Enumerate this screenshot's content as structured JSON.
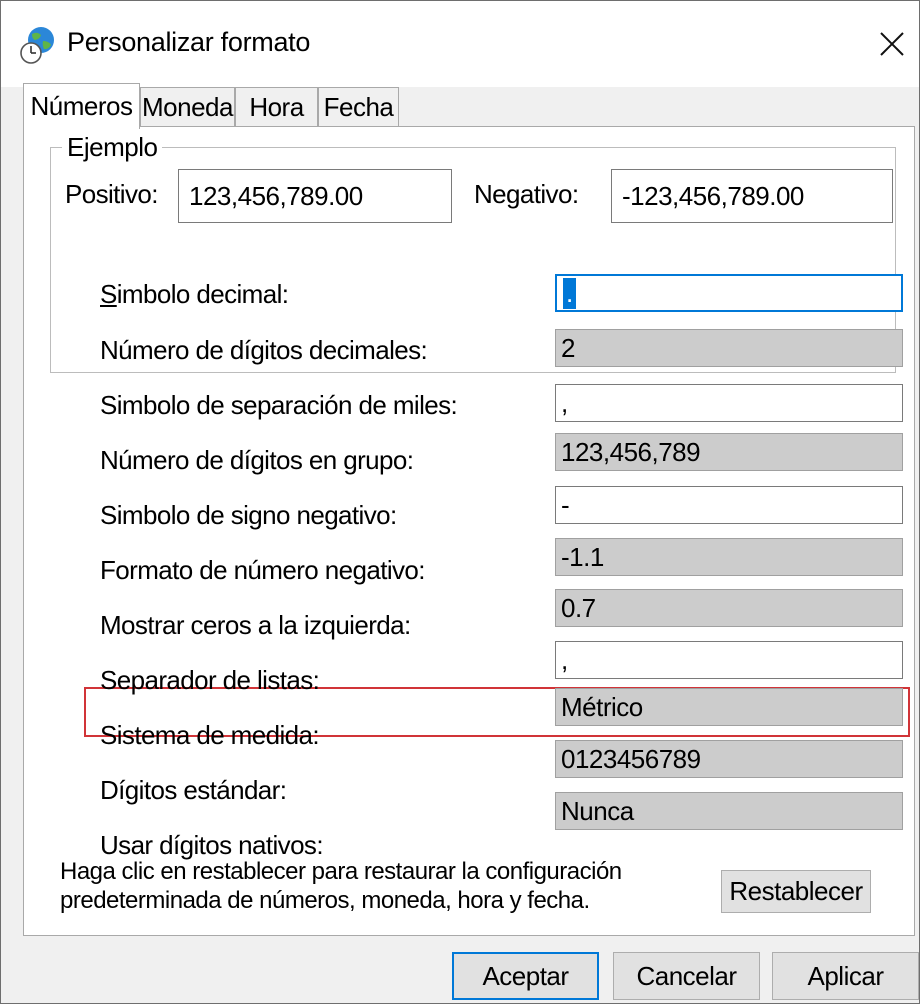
{
  "window": {
    "title": "Personalizar formato"
  },
  "tabs": [
    {
      "label": "Números",
      "active": true
    },
    {
      "label": "Moneda",
      "active": false
    },
    {
      "label": "Hora",
      "active": false
    },
    {
      "label": "Fecha",
      "active": false
    }
  ],
  "example": {
    "title": "Ejemplo",
    "positive_label": "Positivo:",
    "positive_value": "123,456,789.00",
    "negative_label": "Negativo:",
    "negative_value": "-123,456,789.00"
  },
  "settings": [
    {
      "label_mnemonic": "S",
      "label_rest": "imbolo decimal:",
      "value": ".",
      "editable": true
    },
    {
      "label": "Número de dígitos decimales:",
      "value": "2",
      "editable": false
    },
    {
      "label": "Simbolo de separación de miles:",
      "value": ",",
      "editable": true
    },
    {
      "label": "Número de dígitos en grupo:",
      "value": "123,456,789",
      "editable": false
    },
    {
      "label": "Simbolo de signo negativo:",
      "value": "-",
      "editable": true
    },
    {
      "label": "Formato de número negativo:",
      "value": "-1.1",
      "editable": false
    },
    {
      "label": "Mostrar ceros a la izquierda:",
      "value": "0.7",
      "editable": false
    },
    {
      "label": "Separador de listas:",
      "value": ",",
      "editable": true,
      "highlighted": true
    },
    {
      "label": "Sistema de medida:",
      "value": "Métrico",
      "editable": false
    },
    {
      "label": "Dígitos estándar:",
      "value": "0123456789",
      "editable": false
    },
    {
      "label": "Usar dígitos nativos:",
      "value": "Nunca",
      "editable": false
    }
  ],
  "info": {
    "line1": "Haga clic en restablecer para restaurar la configuración",
    "line2": "predeterminada de números, moneda, hora y fecha."
  },
  "buttons": {
    "reset": "Restablecer",
    "ok": "Aceptar",
    "cancel": "Cancelar",
    "apply": "Aplicar"
  },
  "colors": {
    "accent": "#0078d7",
    "highlight": "#d13438",
    "disabled_field": "#cccccc",
    "dialog_bg": "#f0f0f0"
  },
  "icons": {
    "app": "globe-clock-icon",
    "close": "close-icon"
  }
}
